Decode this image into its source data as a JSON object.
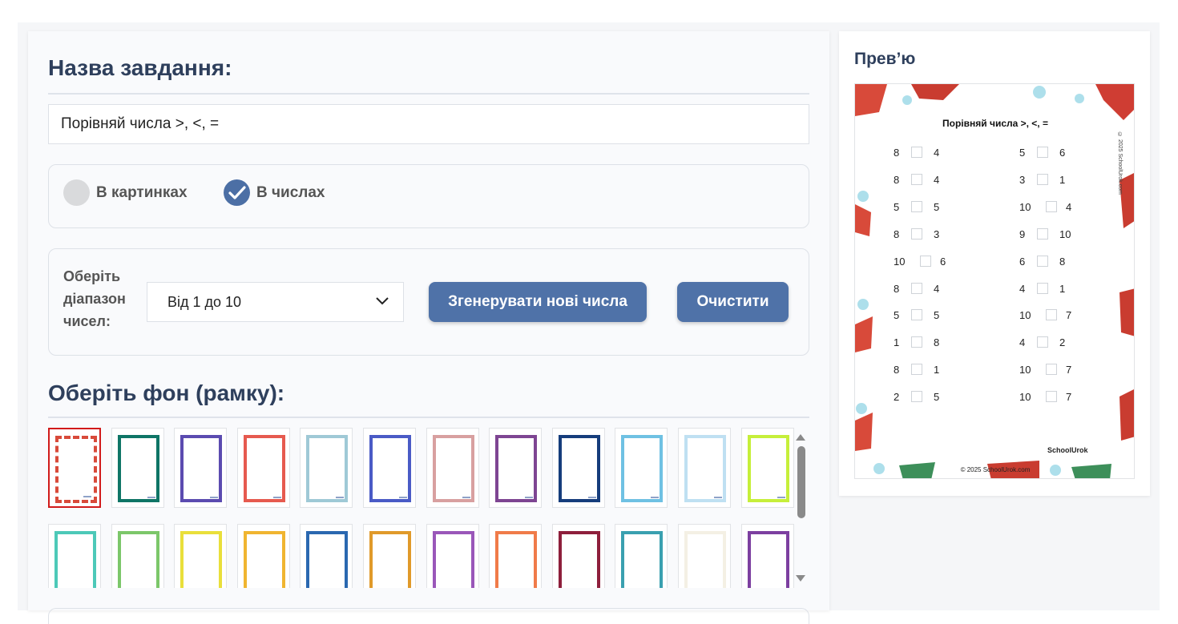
{
  "task": {
    "heading": "Назва завдання:",
    "title_value": "Порівняй числа >, <, ="
  },
  "mode": {
    "options": [
      {
        "label": "В картинках",
        "checked": false
      },
      {
        "label": "В числах",
        "checked": true
      }
    ]
  },
  "range": {
    "label": "Оберіть діапазон чисел:",
    "selected": "Від 1 до 10"
  },
  "buttons": {
    "generate": "Згенерувати нові числа",
    "clear": "Очистити"
  },
  "background": {
    "heading": "Оберіть фон (рамку):",
    "frames": [
      {
        "color": "#e9e9e9",
        "selected": true
      },
      {
        "color": "#0f7566"
      },
      {
        "color": "#5b4bb0"
      },
      {
        "color": "#e65a4f"
      },
      {
        "color": "#9fc9d6"
      },
      {
        "color": "#4a5bc6"
      },
      {
        "color": "#d8a0a0"
      },
      {
        "color": "#7e4592"
      },
      {
        "color": "#163d7c"
      },
      {
        "color": "#6fc1e3"
      },
      {
        "color": "#bfe0f2"
      },
      {
        "color": "#c6ef3a"
      },
      {
        "color": "#4dc9b8"
      },
      {
        "color": "#7cc76a"
      },
      {
        "color": "#e9df3b"
      },
      {
        "color": "#f0b530"
      },
      {
        "color": "#2a68b0"
      },
      {
        "color": "#e09a2a"
      },
      {
        "color": "#9a57b9"
      },
      {
        "color": "#f07b49"
      },
      {
        "color": "#8e1f3c"
      },
      {
        "color": "#3aa0b0"
      },
      {
        "color": "#f4f0e4"
      },
      {
        "color": "#7c3fa0"
      }
    ]
  },
  "preview": {
    "heading": "Прев’ю",
    "sheet_title": "Порівняй числа >, <, =",
    "left_column": [
      [
        "8",
        "4"
      ],
      [
        "8",
        "4"
      ],
      [
        "5",
        "5"
      ],
      [
        "8",
        "3"
      ],
      [
        "10",
        "6"
      ],
      [
        "8",
        "4"
      ],
      [
        "5",
        "5"
      ],
      [
        "1",
        "8"
      ],
      [
        "8",
        "1"
      ],
      [
        "2",
        "5"
      ]
    ],
    "right_column": [
      [
        "5",
        "6"
      ],
      [
        "3",
        "1"
      ],
      [
        "10",
        "4"
      ],
      [
        "9",
        "10"
      ],
      [
        "6",
        "8"
      ],
      [
        "4",
        "1"
      ],
      [
        "10",
        "7"
      ],
      [
        "4",
        "2"
      ],
      [
        "10",
        "7"
      ],
      [
        "10",
        "7"
      ]
    ],
    "brand": "SchoolUrok",
    "footer": "© 2025 SchoolUrok.com",
    "vertical_text": "© 2025 SchoolUrok.com"
  }
}
